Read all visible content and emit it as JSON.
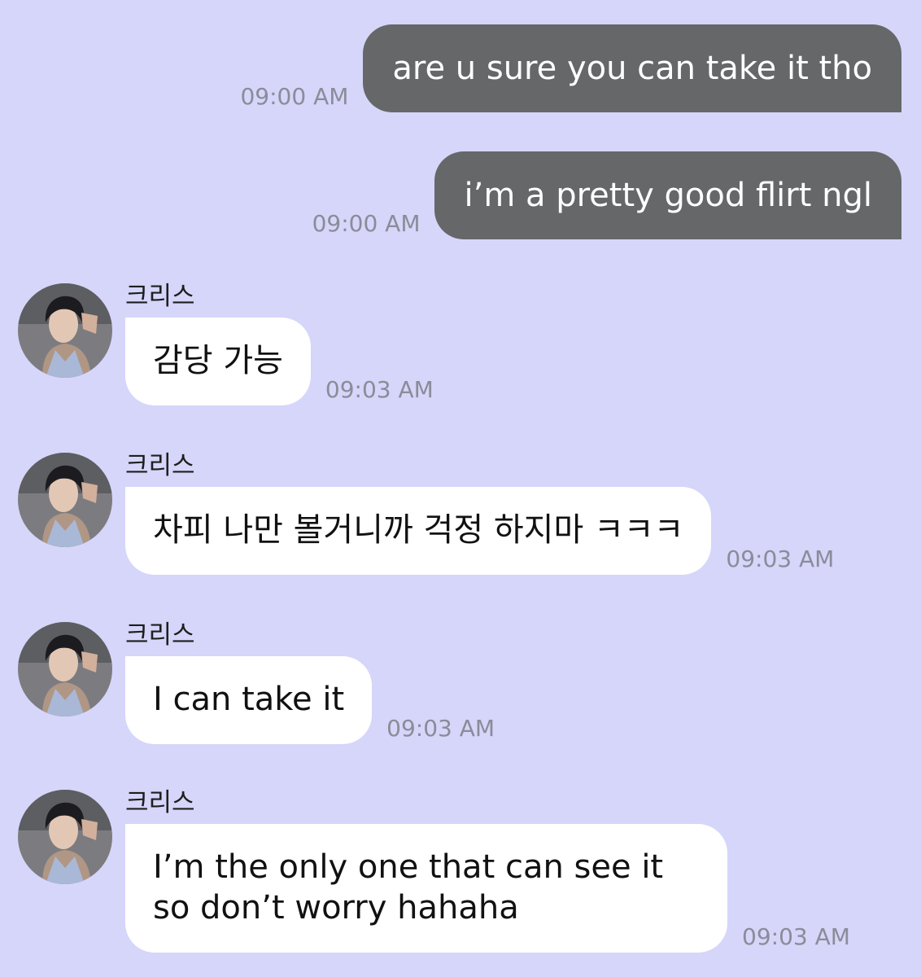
{
  "messages": [
    {
      "direction": "outgoing",
      "text": "are u sure you can take it tho",
      "time": "09:00 AM"
    },
    {
      "direction": "outgoing",
      "text": "i’m a pretty good flirt ngl",
      "time": "09:00 AM"
    },
    {
      "direction": "incoming",
      "sender": "크리스",
      "text": "감당 가능",
      "time": "09:03 AM",
      "avatar": "profile-photo"
    },
    {
      "direction": "incoming",
      "sender": "크리스",
      "text": "차피 나만 볼거니까 걱정 하지마 ㅋㅋㅋ",
      "time": "09:03 AM",
      "avatar": "profile-photo"
    },
    {
      "direction": "incoming",
      "sender": "크리스",
      "text": "I can take it",
      "time": "09:03 AM",
      "avatar": "profile-photo"
    },
    {
      "direction": "incoming",
      "sender": "크리스",
      "text": "I’m the only one that can see it so don’t worry hahaha",
      "time": "09:03 AM",
      "avatar": "profile-photo"
    }
  ],
  "colors": {
    "background": "#d5d6f9",
    "outgoing_bubble": "#666769",
    "incoming_bubble": "#ffffff",
    "timestamp": "#8b8c99"
  }
}
